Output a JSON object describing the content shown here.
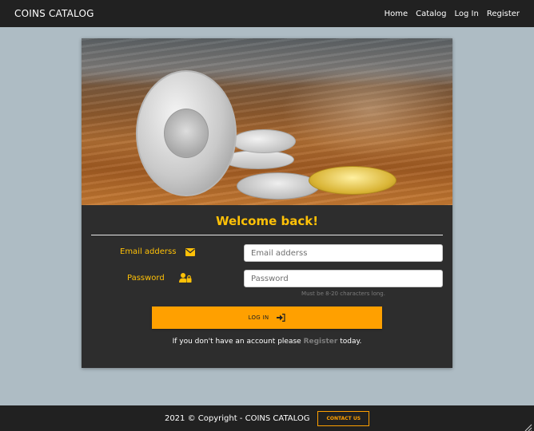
{
  "navbar": {
    "brand": "COINS CATALOG",
    "links": [
      "Home",
      "Catalog",
      "Log In",
      "Register"
    ]
  },
  "login_card": {
    "hero_image": "coins-on-wooden-table",
    "title": "Welcome back!",
    "email": {
      "label": "Email adderss",
      "icon": "envelope-icon",
      "placeholder": "Email adderss",
      "value": ""
    },
    "password": {
      "label": "Password",
      "icon": "user-lock-icon",
      "placeholder": "Password",
      "value": "",
      "hint": "Must be 8-20 characters long."
    },
    "login_button": {
      "label": "LOG IN",
      "icon": "sign-in-icon"
    },
    "register_prompt": {
      "before": "If you don't have an account please",
      "link": "Register",
      "after": "today."
    }
  },
  "footer": {
    "copyright": "2021 © Copyright -  COINS CATALOG",
    "contact_button": "CONTACT US"
  },
  "colors": {
    "accent": "#ffc107",
    "button": "#ffa000",
    "background": "#aebcc4",
    "bar": "#212121",
    "card": "#2d2d2d"
  }
}
